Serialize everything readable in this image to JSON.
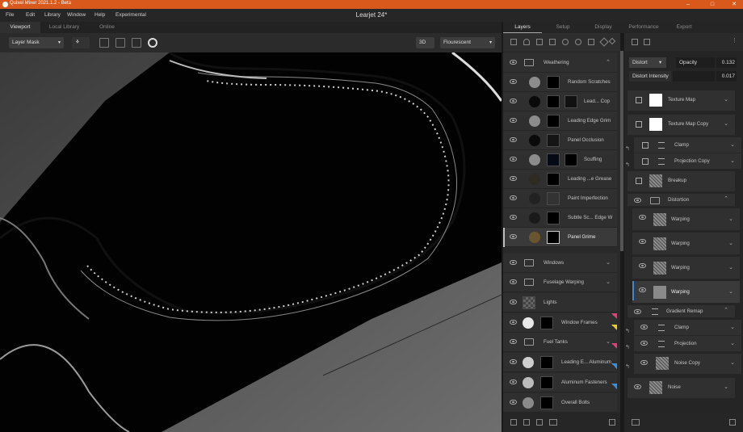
{
  "app": {
    "title": "Quixel Mixer 2021.1.2 - Beta",
    "document": "Learjet 24*",
    "win_min": "–",
    "win_max": "□",
    "win_close": "✕"
  },
  "menu": [
    "File",
    "Edit",
    "Library",
    "Window",
    "Help",
    "Experimental"
  ],
  "viewport_tabs": [
    "Viewport",
    "Local Library",
    "Online"
  ],
  "toolbar": {
    "mask_mode": "Layer Mask",
    "view_mode": "3D",
    "lighting": "Flourescent"
  },
  "right_tabs": [
    "Layers",
    "Setup",
    "Display",
    "Performance",
    "Export"
  ],
  "layers": [
    {
      "name": "Weathering",
      "type": "folder",
      "expanded": true
    },
    {
      "name": "Random Scratches",
      "color": "#8c8c8c",
      "masks": 1
    },
    {
      "name": "Lead... Cop",
      "color": "#0a0a0a",
      "masks": 2
    },
    {
      "name": "Leading Edge Grim",
      "color": "#8c8c8c",
      "masks": 1
    },
    {
      "name": "Panel Occlusion",
      "color": "#0a0a0a",
      "masks": 1
    },
    {
      "name": "Scuffing",
      "color": "#8c8c8c",
      "masks": 2
    },
    {
      "name": "Leading ...e Grease",
      "color": "#2e2b22",
      "masks": 1
    },
    {
      "name": "Paint Imperfection",
      "color": "#222222",
      "masks": 1
    },
    {
      "name": "Subtle Sc... Edge W",
      "color": "#1a1a1a",
      "masks": 1
    },
    {
      "name": "Panel Grime",
      "color": "#6b5530",
      "masks": 1,
      "selected": true
    },
    {
      "name": "Windows",
      "type": "folder"
    },
    {
      "name": "Fuselage Warping",
      "type": "folder"
    },
    {
      "name": "Lights",
      "color": "checker",
      "masks": 0
    },
    {
      "name": "Window Frames",
      "color": "#e8e8e8",
      "masks": 1,
      "tag": "#e0407a"
    },
    {
      "name": "Fuel Tanks",
      "type": "folder",
      "tag": "#e8d020"
    },
    {
      "name": "Leading E... Aluminum",
      "color": "#cfcfcf",
      "masks": 1,
      "tag": "#e0407a"
    },
    {
      "name": "Aluminum Fasteners",
      "color": "#bcbcbc",
      "masks": 1,
      "tag": "#3a8fd8"
    },
    {
      "name": "Overall Bolts",
      "color": "#8a8a8a",
      "masks": 1,
      "tag": "#3a8fd8"
    }
  ],
  "props": {
    "blend": "Distort",
    "opacity_label": "Opacity",
    "opacity_value": "0.132",
    "intensity_label": "Distort Intensity",
    "intensity_value": "0.017"
  },
  "stack": [
    {
      "name": "Texture Map",
      "kind": "check-white"
    },
    {
      "name": "Texture Map Copy",
      "kind": "check-white"
    },
    {
      "name": "Clamp",
      "kind": "sub-adjust"
    },
    {
      "name": "Projection Copy",
      "kind": "sub-adjust"
    },
    {
      "name": "Breakup",
      "kind": "check-noise"
    },
    {
      "name": "Distortion",
      "kind": "folder-open"
    },
    {
      "name": "Warping",
      "kind": "warp"
    },
    {
      "name": "Warping",
      "kind": "warp"
    },
    {
      "name": "Warping",
      "kind": "warp"
    },
    {
      "name": "Warping",
      "kind": "warp-sel"
    },
    {
      "name": "Gradient Remap",
      "kind": "group-open"
    },
    {
      "name": "Clamp",
      "kind": "sub2"
    },
    {
      "name": "Projection",
      "kind": "sub2"
    },
    {
      "name": "Noise Copy",
      "kind": "sub2-noise"
    },
    {
      "name": "Noise",
      "kind": "noise"
    }
  ]
}
